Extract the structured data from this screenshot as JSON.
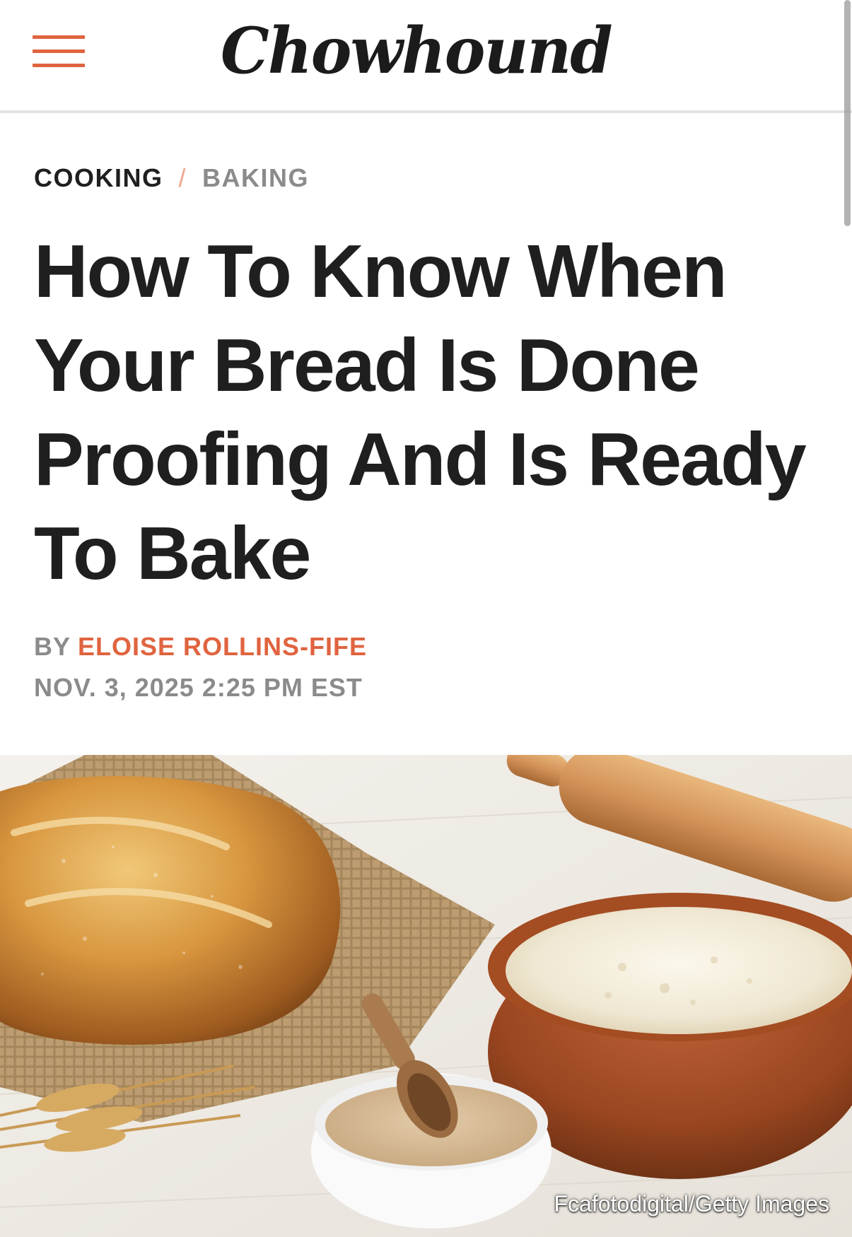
{
  "header": {
    "logo": "Chowhound",
    "menu_icon": "hamburger-menu-icon"
  },
  "breadcrumb": {
    "category": "COOKING",
    "separator": "/",
    "subcategory": "BAKING"
  },
  "article": {
    "title": "How To Know When Your Bread Is Done Proofing And Is Ready To Bake",
    "byline_prefix": "BY",
    "author": "ELOISE ROLLINS-FIFE",
    "date": "NOV. 3, 2025 2:25 PM EST"
  },
  "hero_image": {
    "credit": "Fcafotodigital/Getty Images"
  },
  "colors": {
    "accent": "#e0643f",
    "separator": "#f1a78d",
    "text": "#1f1f1f",
    "muted": "#8b8b8b"
  }
}
